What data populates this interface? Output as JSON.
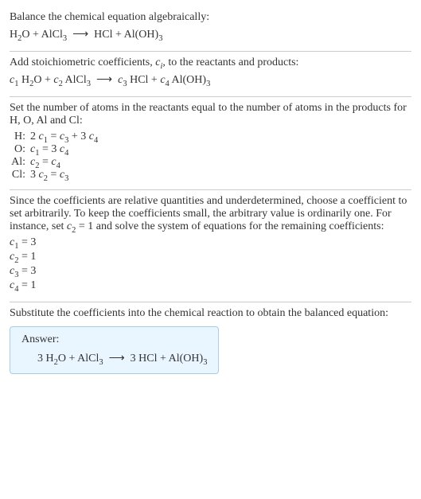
{
  "section1": {
    "prompt": "Balance the chemical equation algebraically:",
    "equation_html": "H<sub>2</sub>O + AlCl<sub>3</sub>&nbsp;&nbsp;<span class='arrow'>⟶</span>&nbsp;&nbsp;HCl + Al(OH)<sub>3</sub>"
  },
  "section2": {
    "prompt_html": "Add stoichiometric coefficients, <i>c<sub>i</sub></i>, to the reactants and products:",
    "equation_html": "<i>c</i><sub>1</sub> H<sub>2</sub>O + <i>c</i><sub>2</sub> AlCl<sub>3</sub>&nbsp;&nbsp;<span class='arrow'>⟶</span>&nbsp;&nbsp;<i>c</i><sub>3</sub> HCl + <i>c</i><sub>4</sub> Al(OH)<sub>3</sub>"
  },
  "section3": {
    "prompt": "Set the number of atoms in the reactants equal to the number of atoms in the products for H, O, Al and Cl:",
    "rows": [
      {
        "label": "H:",
        "value_html": "2 <i>c</i><sub>1</sub> = <i>c</i><sub>3</sub> + 3 <i>c</i><sub>4</sub>"
      },
      {
        "label": "O:",
        "value_html": "<i>c</i><sub>1</sub> = 3 <i>c</i><sub>4</sub>"
      },
      {
        "label": "Al:",
        "value_html": "<i>c</i><sub>2</sub> = <i>c</i><sub>4</sub>"
      },
      {
        "label": "Cl:",
        "value_html": "3 <i>c</i><sub>2</sub> = <i>c</i><sub>3</sub>"
      }
    ]
  },
  "section4": {
    "prompt_html": "Since the coefficients are relative quantities and underdetermined, choose a coefficient to set arbitrarily. To keep the coefficients small, the arbitrary value is ordinarily one. For instance, set <i>c</i><sub>2</sub> = 1 and solve the system of equations for the remaining coefficients:",
    "rows": [
      {
        "value_html": "<i>c</i><sub>1</sub> = 3"
      },
      {
        "value_html": "<i>c</i><sub>2</sub> = 1"
      },
      {
        "value_html": "<i>c</i><sub>3</sub> = 3"
      },
      {
        "value_html": "<i>c</i><sub>4</sub> = 1"
      }
    ]
  },
  "section5": {
    "prompt": "Substitute the coefficients into the chemical reaction to obtain the balanced equation:",
    "answer_label": "Answer:",
    "answer_html": "3 H<sub>2</sub>O + AlCl<sub>3</sub>&nbsp;&nbsp;<span class='arrow'>⟶</span>&nbsp;&nbsp;3 HCl + Al(OH)<sub>3</sub>"
  },
  "chart_data": {
    "type": "table",
    "title": "Balancing H2O + AlCl3 -> HCl + Al(OH)3",
    "atom_balance_equations": [
      {
        "element": "H",
        "equation": "2 c1 = c3 + 3 c4"
      },
      {
        "element": "O",
        "equation": "c1 = 3 c4"
      },
      {
        "element": "Al",
        "equation": "c2 = c4"
      },
      {
        "element": "Cl",
        "equation": "3 c2 = c3"
      }
    ],
    "fixed_coefficient": {
      "name": "c2",
      "value": 1
    },
    "solved_coefficients": {
      "c1": 3,
      "c2": 1,
      "c3": 3,
      "c4": 1
    },
    "balanced_equation": "3 H2O + AlCl3 -> 3 HCl + Al(OH)3"
  }
}
